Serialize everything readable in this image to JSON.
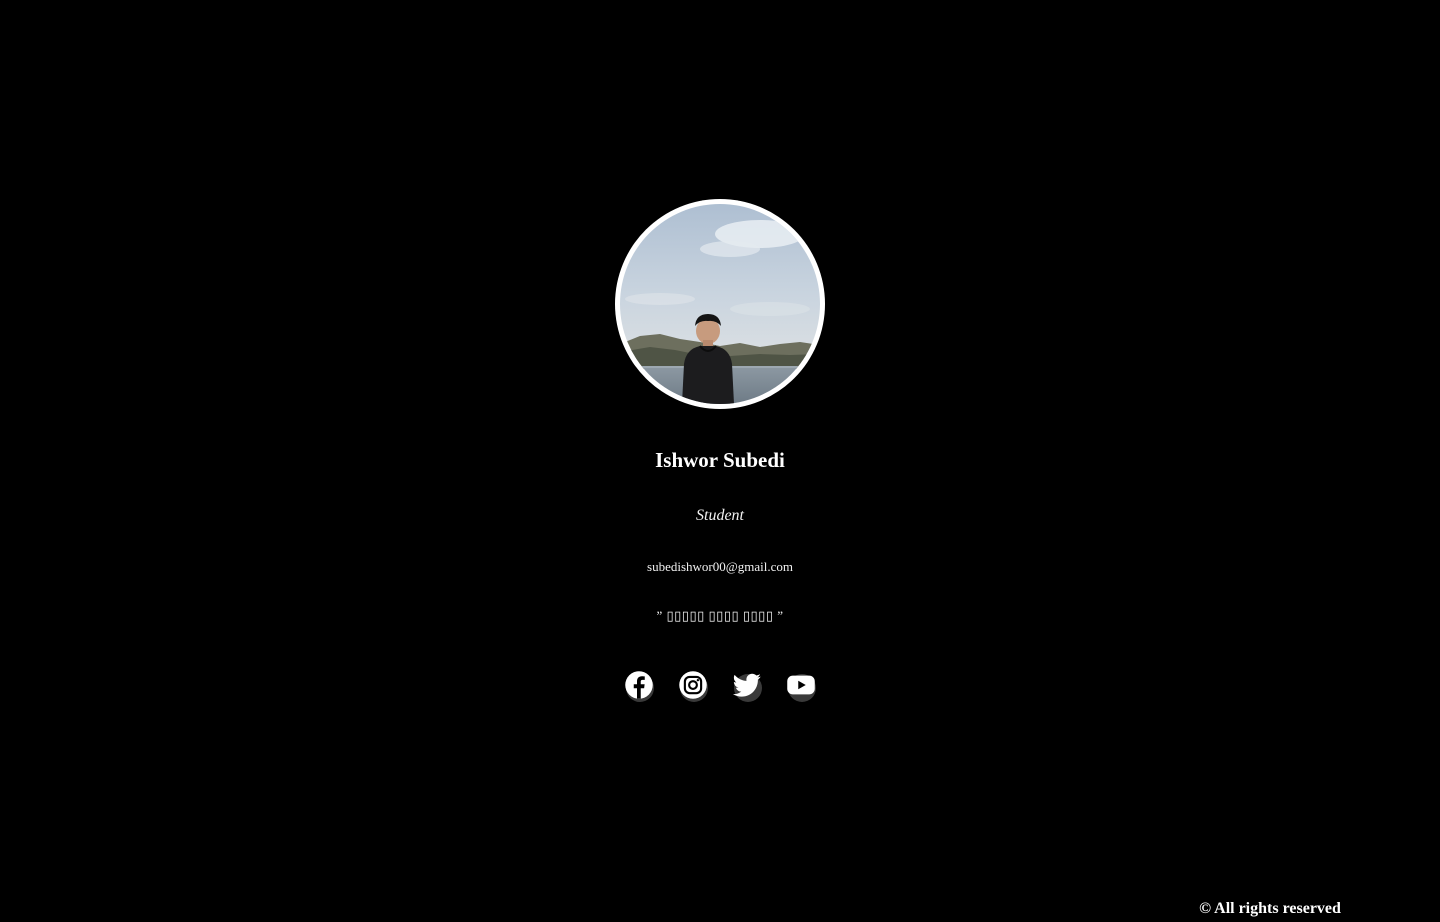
{
  "profile": {
    "name": "Ishwor Subedi",
    "role": "Student",
    "email": "subedishwor00@gmail.com",
    "quote": "” ▯▯▯▯▯ ▯▯▯▯ ▯▯▯▯ ”",
    "avatar_alt": "Ishwor Subedi"
  },
  "socials": [
    {
      "name": "facebook-icon"
    },
    {
      "name": "instagram-icon"
    },
    {
      "name": "twitter-icon"
    },
    {
      "name": "youtube-icon"
    }
  ],
  "footer": {
    "copyright": "© All rights reserved"
  },
  "colors": {
    "background": "#000000",
    "text": "#ffffff",
    "avatar_border": "#ffffff",
    "icon_shadow": "#3a3a3a"
  }
}
